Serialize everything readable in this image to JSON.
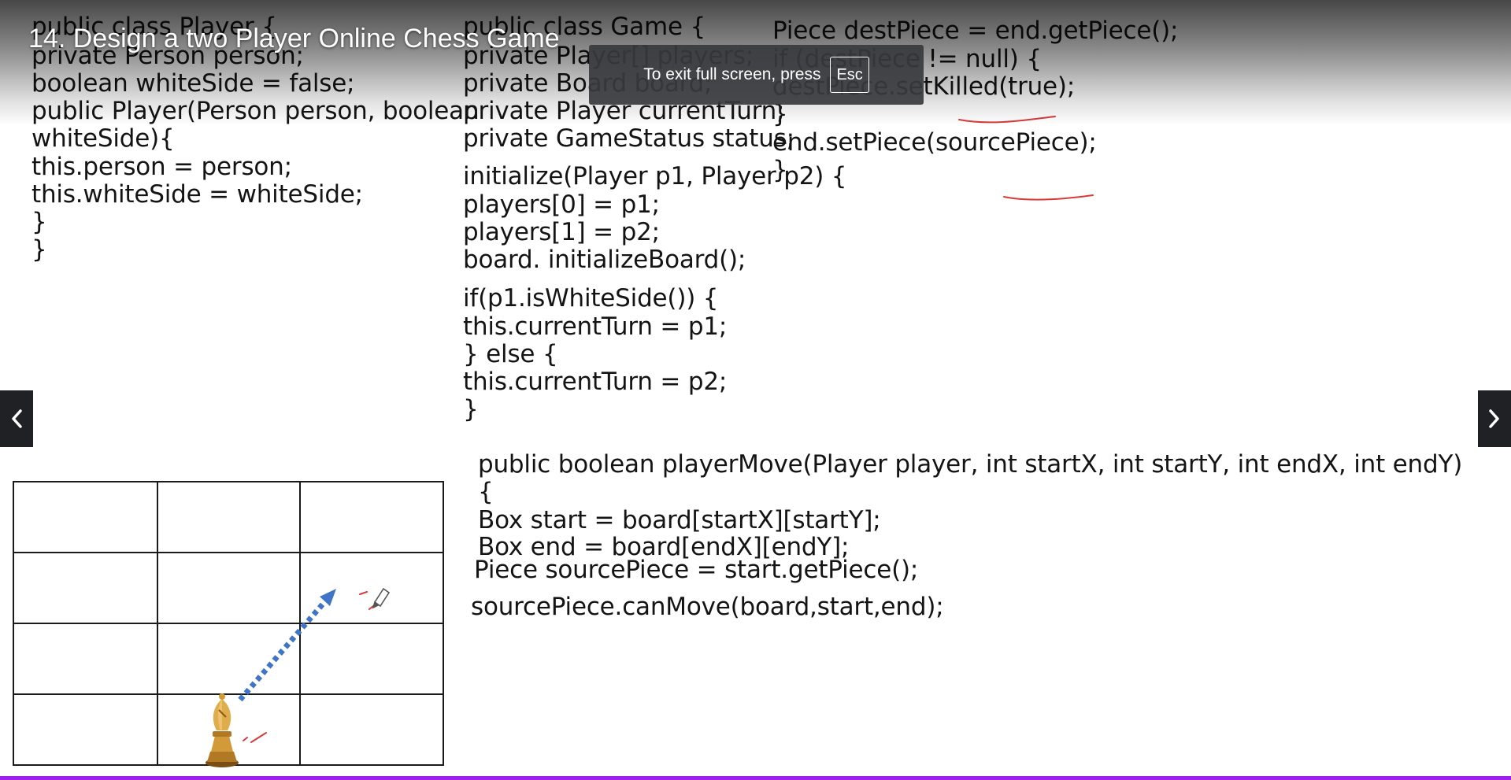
{
  "video": {
    "title": "14. Design a two Player Online Chess Game"
  },
  "fullscreen_toast": {
    "message": "To exit full screen, press",
    "key": "Esc"
  },
  "navigation": {
    "prev_icon": "chevron-left-icon",
    "next_icon": "chevron-right-icon"
  },
  "slide": {
    "player_class": [
      "public class Player {",
      " private Person person;",
      "boolean whiteSide = false;",
      "public Player(Person person, boolean",
      "whiteSide){",
      "this.person = person;",
      "this.whiteSide = whiteSide;",
      "}",
      "}"
    ],
    "game_class": [
      "public class Game {",
      "private Player[] players;",
      "private Board board;",
      "private Player currentTurn;",
      "private GameStatus status;",
      "initialize(Player p1, Player p2) {",
      "players[0] = p1;",
      "players[1] = p2;",
      "board. initializeBoard();",
      "if(p1.isWhiteSide()) {",
      "this.currentTurn = p1;",
      "} else {",
      "this.currentTurn = p2;",
      "}"
    ],
    "dest_piece_block": [
      "Piece destPiece = end.getPiece();",
      "if (destPiece != null) {",
      "destPiece.setKilled(true);",
      "}",
      "end.setPiece(sourcePiece);",
      "}"
    ],
    "player_move_block": [
      "public boolean playerMove(Player player, int startX, int startY, int endX, int endY)",
      "{",
      "Box start = board[startX][startY];",
      "Box end = board[endX][endY];",
      "Piece sourcePiece = start.getPiece();",
      "sourcePiece.canMove(board,start,end);"
    ],
    "annotation_color": "#d93a3a",
    "arrow_color": "#3f74c6",
    "progress_color": "#a020f0"
  }
}
